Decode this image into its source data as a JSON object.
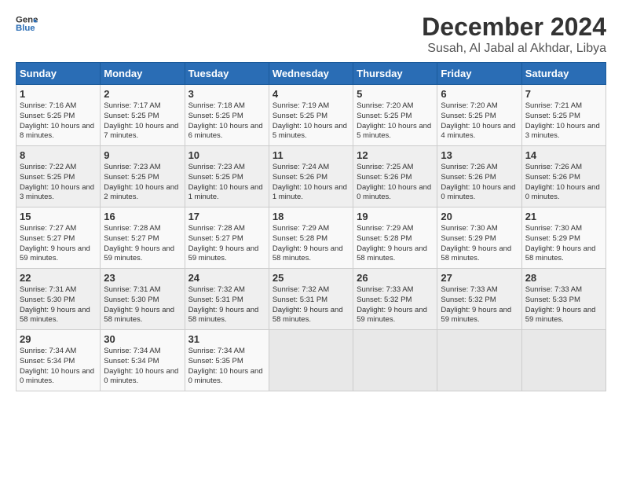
{
  "logo": {
    "line1": "General",
    "line2": "Blue"
  },
  "title": "December 2024",
  "subtitle": "Susah, Al Jabal al Akhdar, Libya",
  "days_of_week": [
    "Sunday",
    "Monday",
    "Tuesday",
    "Wednesday",
    "Thursday",
    "Friday",
    "Saturday"
  ],
  "weeks": [
    [
      {
        "day": "1",
        "sunrise": "7:16 AM",
        "sunset": "5:25 PM",
        "daylight": "10 hours and 8 minutes."
      },
      {
        "day": "2",
        "sunrise": "7:17 AM",
        "sunset": "5:25 PM",
        "daylight": "10 hours and 7 minutes."
      },
      {
        "day": "3",
        "sunrise": "7:18 AM",
        "sunset": "5:25 PM",
        "daylight": "10 hours and 6 minutes."
      },
      {
        "day": "4",
        "sunrise": "7:19 AM",
        "sunset": "5:25 PM",
        "daylight": "10 hours and 5 minutes."
      },
      {
        "day": "5",
        "sunrise": "7:20 AM",
        "sunset": "5:25 PM",
        "daylight": "10 hours and 5 minutes."
      },
      {
        "day": "6",
        "sunrise": "7:20 AM",
        "sunset": "5:25 PM",
        "daylight": "10 hours and 4 minutes."
      },
      {
        "day": "7",
        "sunrise": "7:21 AM",
        "sunset": "5:25 PM",
        "daylight": "10 hours and 3 minutes."
      }
    ],
    [
      {
        "day": "8",
        "sunrise": "7:22 AM",
        "sunset": "5:25 PM",
        "daylight": "10 hours and 3 minutes."
      },
      {
        "day": "9",
        "sunrise": "7:23 AM",
        "sunset": "5:25 PM",
        "daylight": "10 hours and 2 minutes."
      },
      {
        "day": "10",
        "sunrise": "7:23 AM",
        "sunset": "5:25 PM",
        "daylight": "10 hours and 1 minute."
      },
      {
        "day": "11",
        "sunrise": "7:24 AM",
        "sunset": "5:26 PM",
        "daylight": "10 hours and 1 minute."
      },
      {
        "day": "12",
        "sunrise": "7:25 AM",
        "sunset": "5:26 PM",
        "daylight": "10 hours and 0 minutes."
      },
      {
        "day": "13",
        "sunrise": "7:26 AM",
        "sunset": "5:26 PM",
        "daylight": "10 hours and 0 minutes."
      },
      {
        "day": "14",
        "sunrise": "7:26 AM",
        "sunset": "5:26 PM",
        "daylight": "10 hours and 0 minutes."
      }
    ],
    [
      {
        "day": "15",
        "sunrise": "7:27 AM",
        "sunset": "5:27 PM",
        "daylight": "9 hours and 59 minutes."
      },
      {
        "day": "16",
        "sunrise": "7:28 AM",
        "sunset": "5:27 PM",
        "daylight": "9 hours and 59 minutes."
      },
      {
        "day": "17",
        "sunrise": "7:28 AM",
        "sunset": "5:27 PM",
        "daylight": "9 hours and 59 minutes."
      },
      {
        "day": "18",
        "sunrise": "7:29 AM",
        "sunset": "5:28 PM",
        "daylight": "9 hours and 58 minutes."
      },
      {
        "day": "19",
        "sunrise": "7:29 AM",
        "sunset": "5:28 PM",
        "daylight": "9 hours and 58 minutes."
      },
      {
        "day": "20",
        "sunrise": "7:30 AM",
        "sunset": "5:29 PM",
        "daylight": "9 hours and 58 minutes."
      },
      {
        "day": "21",
        "sunrise": "7:30 AM",
        "sunset": "5:29 PM",
        "daylight": "9 hours and 58 minutes."
      }
    ],
    [
      {
        "day": "22",
        "sunrise": "7:31 AM",
        "sunset": "5:30 PM",
        "daylight": "9 hours and 58 minutes."
      },
      {
        "day": "23",
        "sunrise": "7:31 AM",
        "sunset": "5:30 PM",
        "daylight": "9 hours and 58 minutes."
      },
      {
        "day": "24",
        "sunrise": "7:32 AM",
        "sunset": "5:31 PM",
        "daylight": "9 hours and 58 minutes."
      },
      {
        "day": "25",
        "sunrise": "7:32 AM",
        "sunset": "5:31 PM",
        "daylight": "9 hours and 58 minutes."
      },
      {
        "day": "26",
        "sunrise": "7:33 AM",
        "sunset": "5:32 PM",
        "daylight": "9 hours and 59 minutes."
      },
      {
        "day": "27",
        "sunrise": "7:33 AM",
        "sunset": "5:32 PM",
        "daylight": "9 hours and 59 minutes."
      },
      {
        "day": "28",
        "sunrise": "7:33 AM",
        "sunset": "5:33 PM",
        "daylight": "9 hours and 59 minutes."
      }
    ],
    [
      {
        "day": "29",
        "sunrise": "7:34 AM",
        "sunset": "5:34 PM",
        "daylight": "10 hours and 0 minutes."
      },
      {
        "day": "30",
        "sunrise": "7:34 AM",
        "sunset": "5:34 PM",
        "daylight": "10 hours and 0 minutes."
      },
      {
        "day": "31",
        "sunrise": "7:34 AM",
        "sunset": "5:35 PM",
        "daylight": "10 hours and 0 minutes."
      },
      null,
      null,
      null,
      null
    ]
  ]
}
